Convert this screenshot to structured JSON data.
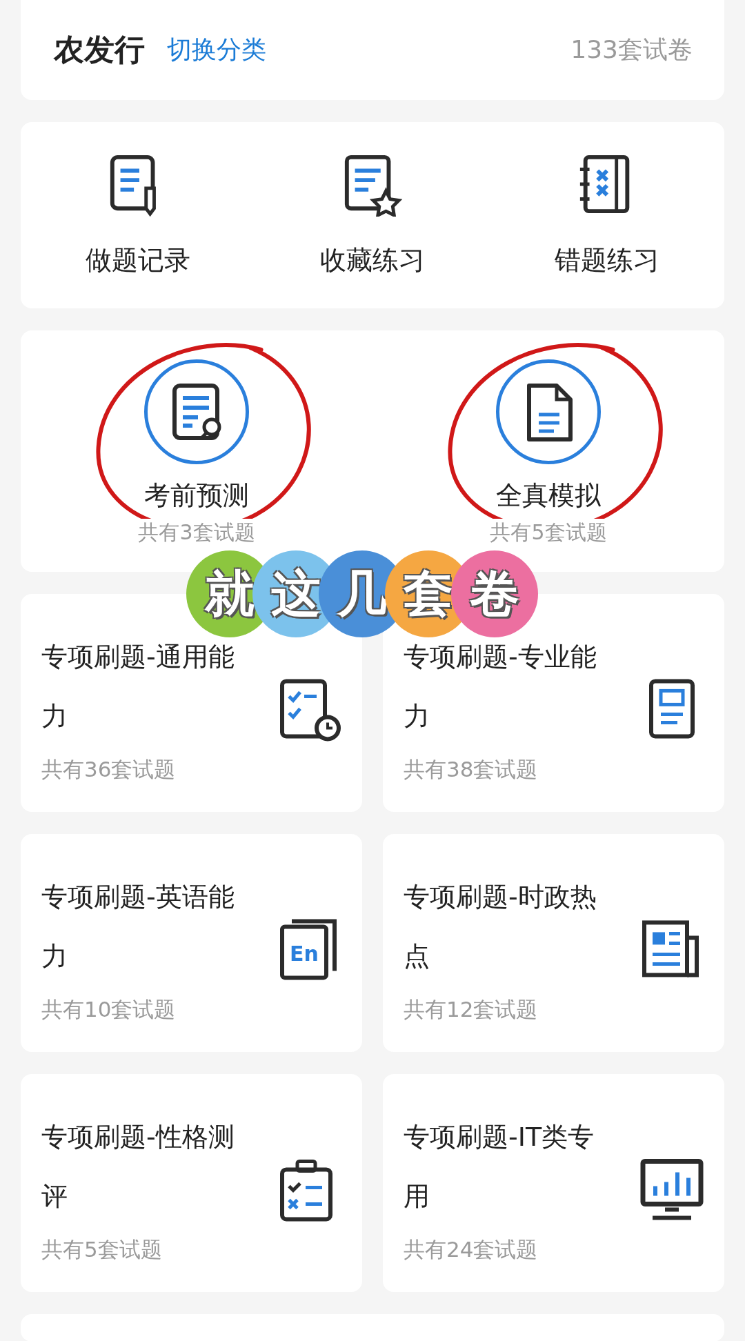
{
  "header": {
    "title": "农发行",
    "switch_link": "切换分类",
    "total": "133套试卷"
  },
  "quick_actions": [
    {
      "label": "做题记录"
    },
    {
      "label": "收藏练习"
    },
    {
      "label": "错题练习"
    }
  ],
  "featured": [
    {
      "label": "考前预测",
      "count": "共有3套试题",
      "circled": true
    },
    {
      "label": "全真模拟",
      "count": "共有5套试题",
      "circled": true
    }
  ],
  "categories": [
    {
      "title": "专项刷题-通用能力",
      "count": "共有36套试题"
    },
    {
      "title": "专项刷题-专业能力",
      "count": "共有38套试题"
    },
    {
      "title": "专项刷题-英语能力",
      "count": "共有10套试题",
      "icon_text": "En"
    },
    {
      "title": "专项刷题-时政热点",
      "count": "共有12套试题"
    },
    {
      "title": "专项刷题-性格测评",
      "count": "共有5套试题"
    },
    {
      "title": "专项刷题-IT类专用",
      "count": "共有24套试题"
    }
  ],
  "sticker": [
    {
      "char": "就",
      "color": "#8cc63f"
    },
    {
      "char": "这",
      "color": "#7cc2ec"
    },
    {
      "char": "几",
      "color": "#4a8fd8"
    },
    {
      "char": "套",
      "color": "#f5a742"
    },
    {
      "char": "卷",
      "color": "#ec6fa0"
    }
  ]
}
